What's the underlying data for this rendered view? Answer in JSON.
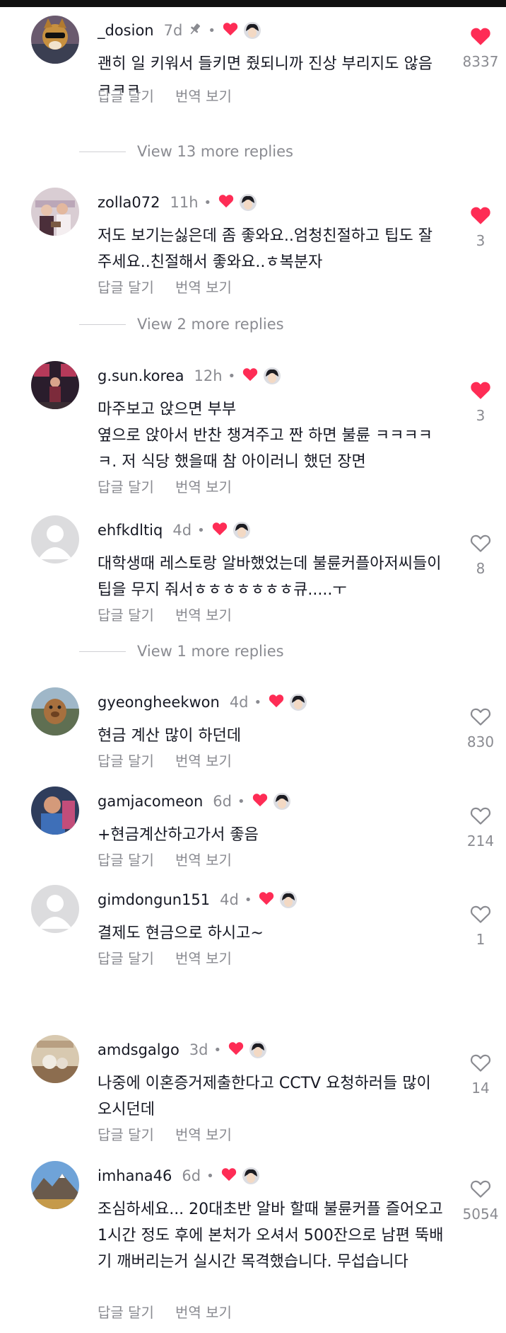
{
  "colors": {
    "heart_red": "#fe2c55",
    "gray": "#8a8b91"
  },
  "actions": {
    "reply": "답글 달기",
    "translate": "번역 보기"
  },
  "comments": [
    {
      "username": "_dosion",
      "time": "7d",
      "pinned": true,
      "text": "괜히 일 키워서 들키면 줬되니까 진상 부리지도 않음 ㅋㅋㅋ",
      "likes": "8337",
      "liked": true,
      "more_replies": "View 13 more replies"
    },
    {
      "username": "zolla072",
      "time": "11h",
      "pinned": false,
      "text": "저도 보기는싫은데 좀 좋와요..엄청친절하고 팁도 잘주세요..친절해서 좋와요..ㅎ복분자",
      "likes": "3",
      "liked": true,
      "more_replies": "View 2 more replies"
    },
    {
      "username": "g.sun.korea",
      "time": "12h",
      "pinned": false,
      "text": "마주보고 앉으면 부부\n옆으로 앉아서 반찬 챙겨주고 짠 하면 불륜 ㅋㅋㅋㅋㅋ. 저 식당 했을때 참 아이러니 했던 장면",
      "likes": "3",
      "liked": true,
      "more_replies": ""
    },
    {
      "username": "ehfkdltiq",
      "time": "4d",
      "pinned": false,
      "text": "대학생때 레스토랑 알바했었는데 불륜커플아저씨들이 팁을 무지 줘서ㅎㅎㅎㅎㅎㅎㅎ큐.....ㅜ",
      "likes": "8",
      "liked": false,
      "more_replies": "View 1 more replies"
    },
    {
      "username": "gyeongheekwon",
      "time": "4d",
      "pinned": false,
      "text": "현금 계산 많이 하던데",
      "likes": "830",
      "liked": false,
      "more_replies": ""
    },
    {
      "username": "gamjacomeon",
      "time": "6d",
      "pinned": false,
      "text": "+현금계산하고가서 좋음",
      "likes": "214",
      "liked": false,
      "more_replies": ""
    },
    {
      "username": "gimdongun151",
      "time": "4d",
      "pinned": false,
      "text": "결제도 현금으로 하시고~",
      "likes": "1",
      "liked": false,
      "more_replies": ""
    },
    {
      "username": "amdsgalgo",
      "time": "3d",
      "pinned": false,
      "text": "나중에 이혼증거제출한다고 CCTV 요청하러들 많이 오시던데",
      "likes": "14",
      "liked": false,
      "more_replies": ""
    },
    {
      "username": "imhana46",
      "time": "6d",
      "pinned": false,
      "text": "조심하세요... 20대초반 알바 할때 불륜커플 즐어오고 1시간 정도 후에 본처가 오셔서 500잔으로 남편 뚝배기 깨버리는거 실시간 목격했습니다. 무섭습니다",
      "likes": "5054",
      "liked": false,
      "more_replies": ""
    }
  ]
}
